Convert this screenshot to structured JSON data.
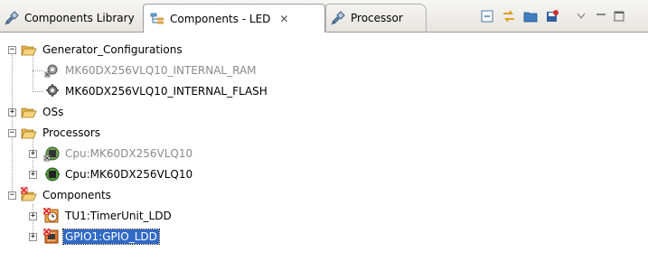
{
  "tabs": [
    {
      "label": "Components Library",
      "icon": "plug-icon"
    },
    {
      "label": "Components - LED",
      "icon": "components-view-icon",
      "close": "✕"
    },
    {
      "label": "Processor",
      "icon": "plug-icon"
    }
  ],
  "toolbar": {
    "buttons": [
      "collapse-all-icon",
      "link-with-editor-icon",
      "new-folder-icon",
      "save-icon",
      "view-menu-icon",
      "minimize-icon",
      "maximize-icon"
    ]
  },
  "tree": {
    "generator": {
      "label": "Generator_Configurations",
      "children": [
        {
          "label": "MK60DX256VLQ10_INTERNAL_RAM",
          "enabled": false
        },
        {
          "label": "MK60DX256VLQ10_INTERNAL_FLASH",
          "enabled": true
        }
      ]
    },
    "oss": {
      "label": "OSs"
    },
    "processors": {
      "label": "Processors",
      "children": [
        {
          "label": "Cpu:MK60DX256VLQ10",
          "enabled": false
        },
        {
          "label": "Cpu:MK60DX256VLQ10",
          "enabled": true
        }
      ]
    },
    "components": {
      "label": "Components",
      "children": [
        {
          "label": "TU1:TimerUnit_LDD",
          "selected": false
        },
        {
          "label": "GPIO1:GPIO_LDD",
          "selected": true
        }
      ]
    }
  },
  "colors": {
    "selection": "#316ac5",
    "folder": "#f2c75a",
    "disabled_text": "#8a8a8a"
  }
}
